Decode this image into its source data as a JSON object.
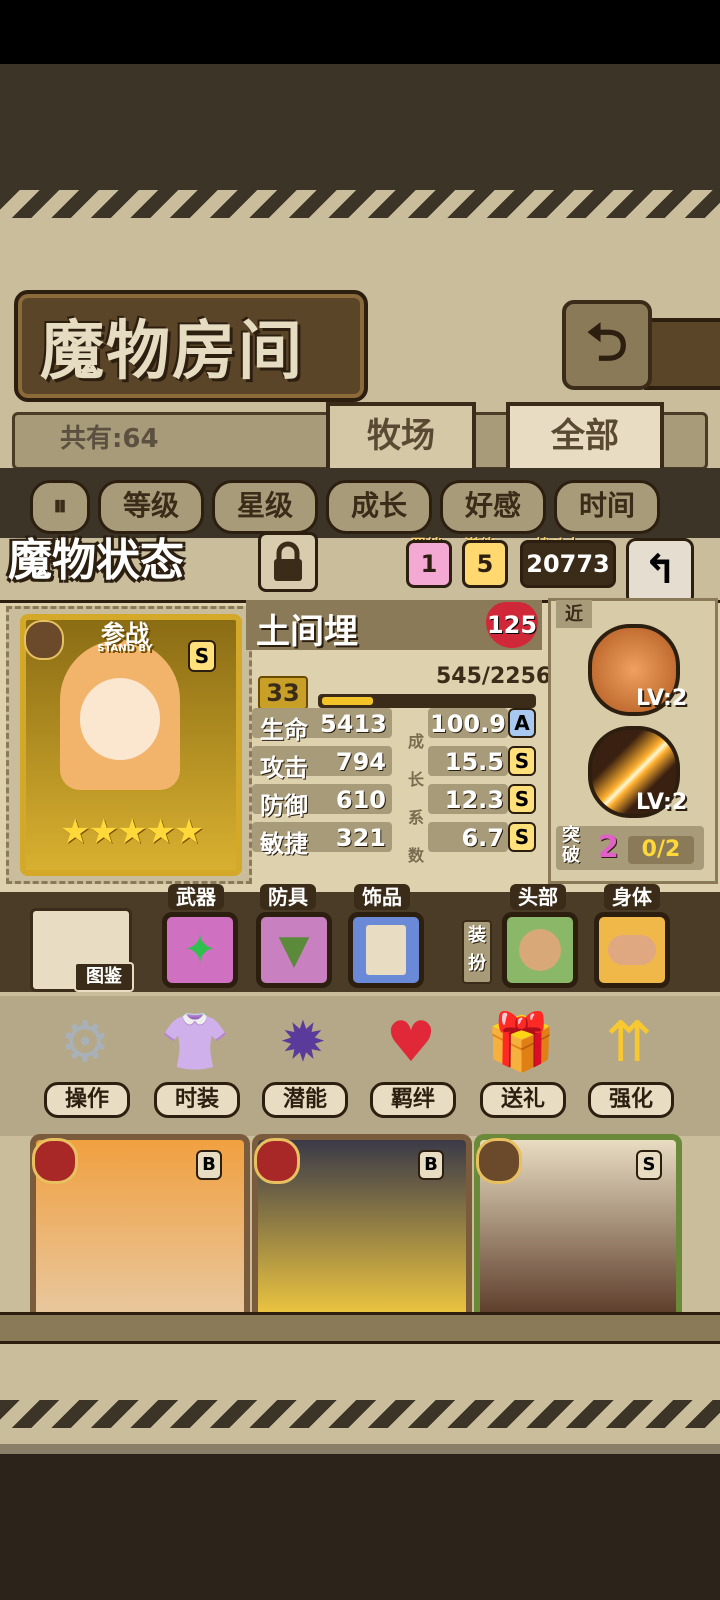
{
  "header": {
    "title": "魔物房间",
    "back_icon": "return-arrow-icon"
  },
  "collection": {
    "count_text": "共有:64",
    "tabs": [
      {
        "label": "牧场"
      },
      {
        "label": "全部"
      }
    ]
  },
  "sort": {
    "toggle_icon": "sort-toggle-icon",
    "buttons": [
      {
        "label": "等级"
      },
      {
        "label": "星级"
      },
      {
        "label": "成长"
      },
      {
        "label": "好感"
      },
      {
        "label": "时间"
      }
    ]
  },
  "status": {
    "title": "魔物状态",
    "lock_icon": "padlock-icon",
    "bond_label": "羁绊",
    "bond_value": "1",
    "potential_label": "潜能",
    "potential_value": "5",
    "power_label": "战斗力",
    "power_value": "20773"
  },
  "monster": {
    "standby_label": "参战",
    "standby_en": "STAND BY",
    "rank": "S",
    "stars": "★★★★★",
    "star_count": 5,
    "name": "土间埋",
    "affection": "125",
    "level": "33",
    "exp_text": "545/2256",
    "exp_fraction": 0.2416,
    "growth_side_label": [
      "成",
      "长",
      "系",
      "数"
    ],
    "stats": [
      {
        "label": "生命",
        "value": "5413",
        "growth": "100.9",
        "grade": "A"
      },
      {
        "label": "攻击",
        "value": "794",
        "growth": "15.5",
        "grade": "S"
      },
      {
        "label": "防御",
        "value": "610",
        "growth": "12.3",
        "grade": "S"
      },
      {
        "label": "敏捷",
        "value": "321",
        "growth": "6.7",
        "grade": "S"
      }
    ]
  },
  "skills": {
    "range_label": "近",
    "items": [
      {
        "level": "LV:2"
      },
      {
        "level": "LV:2"
      }
    ],
    "break_label": "突破",
    "break_value": "2",
    "break_progress": "0/2"
  },
  "equipment": {
    "book_label": "图鉴",
    "weapon_label": "武器",
    "armor_label": "防具",
    "accessory_label": "饰品",
    "dress_label": "装扮",
    "head_label": "头部",
    "body_label": "身体"
  },
  "actions": [
    {
      "label": "操作",
      "icon": "gear-icon"
    },
    {
      "label": "时装",
      "icon": "outfit-icon"
    },
    {
      "label": "潜能",
      "icon": "demon-spirit-icon"
    },
    {
      "label": "羁绊",
      "icon": "hearts-icon"
    },
    {
      "label": "送礼",
      "icon": "gift-icon"
    },
    {
      "label": "强化",
      "icon": "upgrade-arrows-icon"
    }
  ],
  "cards": [
    {
      "rank": "B",
      "element": "fire"
    },
    {
      "rank": "B",
      "element": "fire"
    },
    {
      "rank": "S",
      "element": "earth"
    }
  ]
}
